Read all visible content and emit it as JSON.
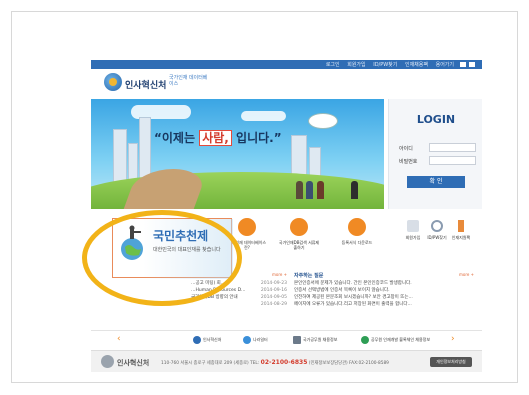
{
  "topbar": {
    "links": [
      "로그인",
      "회원가입",
      "ID/PW찾기",
      "인재채용팩",
      "용어가기"
    ]
  },
  "header": {
    "site_name": "인사혁신처",
    "sub_brand": "국가인재 데이터베이스"
  },
  "hero": {
    "slogan_prefix": "“이제는",
    "slogan_highlight": "사람,",
    "slogan_suffix": "입니다.”"
  },
  "login": {
    "title": "LOGIN",
    "id_label": "아이디",
    "pw_label": "비밀번호",
    "submit_label": "확 인"
  },
  "services": [
    {
      "caption": "국가인재 데이터베이스란?"
    },
    {
      "caption": "국가인재DB검색 서류제출하기"
    },
    {
      "caption": "등록서식 다운로드"
    }
  ],
  "quick_links": [
    {
      "caption": "회원가입"
    },
    {
      "caption": "ID/PW찾기"
    },
    {
      "caption": "인재지원팩"
    }
  ],
  "callout": {
    "title": "국민추천제",
    "subtitle": "대한민국의 대표인재를 찾습니다"
  },
  "news_left": {
    "more": "more +",
    "items": [
      {
        "text": "…공고 미팅) 회…",
        "date": "2014-09-23"
      },
      {
        "text": "…Human Resources D…",
        "date": "2014-09-16"
      },
      {
        "text": "국가인재DB 방향의 안내",
        "date": "2014-09-05"
      },
      {
        "text": "",
        "date": "2014-08-29"
      }
    ]
  },
  "faq": {
    "title": "자주하는 질문",
    "more": "more +",
    "items": [
      "본인인증서에 문제가 있습니다. 간인 본인인증코드 발생합니다.",
      "인증서 선택방법에 인증서 목록이 보이지 않습니다.",
      "인전하여 제공된 본문조회 보시겠습니까? 보안 경고창이 뜨는...",
      "페이지에 오류가 있습니다.리고 저장된 화면이 출력을 합니다..."
    ]
  },
  "links_bar": {
    "prev": "‹",
    "next": "›",
    "items": [
      "인사혁신처",
      "나라일터",
      "국가공무원 채용정보",
      "공무원 인재개발 블록체인 채용정보"
    ]
  },
  "footer": {
    "org": "인사혁신처",
    "address": "110-760 서울시 종로구 세종대로 209 (세종로) TEL:",
    "phone": "02-2100-6835",
    "address_tail": "(민재정보보장담당관) FAX:02-2100-8589",
    "button": "개인정보처리방침"
  },
  "colors": {
    "brand_blue": "#2f6db5",
    "accent_orange": "#f08a24",
    "highlight_ring": "#f2b318"
  }
}
